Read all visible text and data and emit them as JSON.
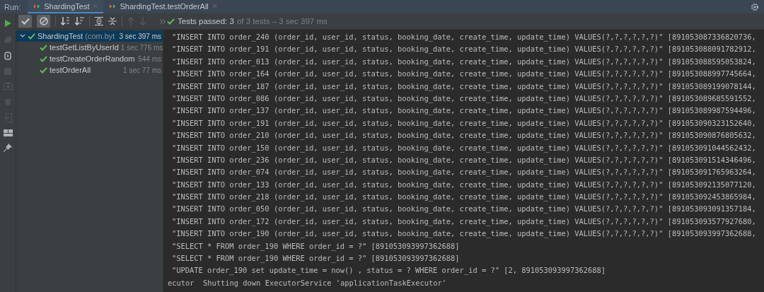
{
  "run_label": "Run:",
  "tabs": [
    {
      "label": "ShardingTest",
      "selected": true
    },
    {
      "label": "ShardingTest.testOrderAll",
      "selected": false
    }
  ],
  "status": {
    "summary": "Tests passed: 3",
    "detail": "of 3 tests – 3 sec 397 ms"
  },
  "tree": {
    "name": "ShardingTest",
    "package": "(com.byt",
    "time": "3 sec 397 ms",
    "expanded": true,
    "selected": true,
    "children": [
      {
        "name": "testGetListByUserId",
        "time": "1 sec 776 ms",
        "selected": false
      },
      {
        "name": "testCreateOrderRandom",
        "time": "544 ms",
        "selected": false
      },
      {
        "name": "testOrderAll",
        "time": "1 sec 77 ms",
        "selected": false
      }
    ]
  },
  "toolbar": {
    "show_passed": {
      "on": true
    },
    "show_ignored": {
      "on": true
    }
  },
  "console": [
    {
      "kind": "sql",
      "text": "\"INSERT INTO order_240 (order_id, user_id, status, booking_date, create_time, update_time) VALUES(?,?,?,?,?,?)\" [891053087336820736,"
    },
    {
      "kind": "sql",
      "text": "\"INSERT INTO order_191 (order_id, user_id, status, booking_date, create_time, update_time) VALUES(?,?,?,?,?,?)\" [891053088091782912,"
    },
    {
      "kind": "sql",
      "text": "\"INSERT INTO order_013 (order_id, user_id, status, booking_date, create_time, update_time) VALUES(?,?,?,?,?,?)\" [891053088595053824,"
    },
    {
      "kind": "sql",
      "text": "\"INSERT INTO order_164 (order_id, user_id, status, booking_date, create_time, update_time) VALUES(?,?,?,?,?,?)\" [891053088997745664,"
    },
    {
      "kind": "sql",
      "text": "\"INSERT INTO order_187 (order_id, user_id, status, booking_date, create_time, update_time) VALUES(?,?,?,?,?,?)\" [891053089199078144,"
    },
    {
      "kind": "sql",
      "text": "\"INSERT INTO order_086 (order_id, user_id, status, booking_date, create_time, update_time) VALUES(?,?,?,?,?,?)\" [891053089685591552,"
    },
    {
      "kind": "sql",
      "text": "\"INSERT INTO order_137 (order_id, user_id, status, booking_date, create_time, update_time) VALUES(?,?,?,?,?,?)\" [891053089987594496,"
    },
    {
      "kind": "sql",
      "text": "\"INSERT INTO order_191 (order_id, user_id, status, booking_date, create_time, update_time) VALUES(?,?,?,?,?,?)\" [891053090323152640,"
    },
    {
      "kind": "sql",
      "text": "\"INSERT INTO order_210 (order_id, user_id, status, booking_date, create_time, update_time) VALUES(?,?,?,?,?,?)\" [891053090876805632,"
    },
    {
      "kind": "sql",
      "text": "\"INSERT INTO order_150 (order_id, user_id, status, booking_date, create_time, update_time) VALUES(?,?,?,?,?,?)\" [891053091044562432,"
    },
    {
      "kind": "sql",
      "text": "\"INSERT INTO order_236 (order_id, user_id, status, booking_date, create_time, update_time) VALUES(?,?,?,?,?,?)\" [891053091514346496,"
    },
    {
      "kind": "sql",
      "text": "\"INSERT INTO order_074 (order_id, user_id, status, booking_date, create_time, update_time) VALUES(?,?,?,?,?,?)\" [891053091765963264,"
    },
    {
      "kind": "sql",
      "text": "\"INSERT INTO order_133 (order_id, user_id, status, booking_date, create_time, update_time) VALUES(?,?,?,?,?,?)\" [891053092135077120,"
    },
    {
      "kind": "sql",
      "text": "\"INSERT INTO order_218 (order_id, user_id, status, booking_date, create_time, update_time) VALUES(?,?,?,?,?,?)\" [891053092453865984,"
    },
    {
      "kind": "sql",
      "text": "\"INSERT INTO order_050 (order_id, user_id, status, booking_date, create_time, update_time) VALUES(?,?,?,?,?,?)\" [891053093091357184,"
    },
    {
      "kind": "sql",
      "text": "\"INSERT INTO order_172 (order_id, user_id, status, booking_date, create_time, update_time) VALUES(?,?,?,?,?,?)\" [891053093577927680,"
    },
    {
      "kind": "sql",
      "text": "\"INSERT INTO order_190 (order_id, user_id, status, booking_date, create_time, update_time) VALUES(?,?,?,?,?,?)\" [891053093997362688,"
    },
    {
      "kind": "sql",
      "text": "\"SELECT * FROM order_190 WHERE order_id = ?\" [891053093997362688]"
    },
    {
      "kind": "sql",
      "text": "\"SELECT * FROM order_190 WHERE order_id = ?\" [891053093997362688]"
    },
    {
      "kind": "sql",
      "text": "\"UPDATE order_190 set update_time = now() , status = ? WHERE order_id = ?\" [2, 891053093997362688]"
    },
    {
      "kind": "log",
      "text": "ecutor  Shutting down ExecutorService 'applicationTaskExecutor'"
    }
  ]
}
